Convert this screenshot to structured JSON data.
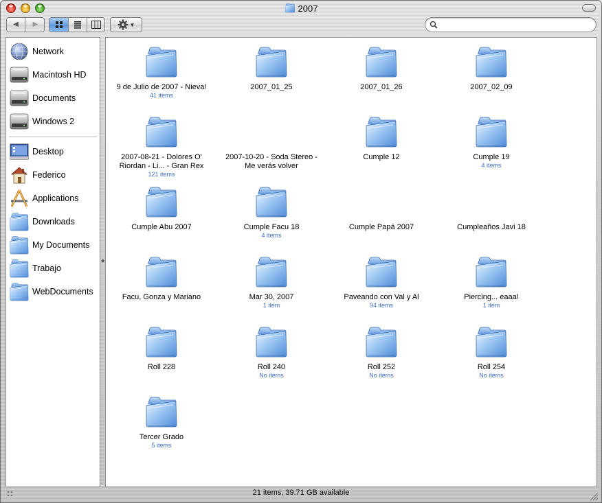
{
  "window": {
    "title": "2007"
  },
  "search": {
    "value": "",
    "placeholder": ""
  },
  "sidebar": {
    "devices": [
      {
        "label": "Network",
        "icon": "network-globe-icon"
      },
      {
        "label": "Macintosh HD",
        "icon": "hard-drive-icon"
      },
      {
        "label": "Documents",
        "icon": "hard-drive-icon"
      },
      {
        "label": "Windows 2",
        "icon": "hard-drive-icon"
      }
    ],
    "places": [
      {
        "label": "Desktop",
        "icon": "desktop-icon"
      },
      {
        "label": "Federico",
        "icon": "home-icon"
      },
      {
        "label": "Applications",
        "icon": "applications-icon"
      },
      {
        "label": "Downloads",
        "icon": "folder-icon"
      },
      {
        "label": "My Documents",
        "icon": "folder-icon"
      },
      {
        "label": "Trabajo",
        "icon": "folder-icon"
      },
      {
        "label": "WebDocuments",
        "icon": "folder-icon"
      }
    ]
  },
  "items": [
    {
      "name": "9 de Julio de 2007 - Nieva!",
      "count": "41 items"
    },
    {
      "name": "2007_01_25",
      "count": ""
    },
    {
      "name": "2007_01_26",
      "count": ""
    },
    {
      "name": "2007_02_09",
      "count": ""
    },
    {
      "name": "2007-08-21 - Dolores O' Riordan - Li... - Gran Rex",
      "count": "121 items"
    },
    {
      "name": "2007-10-20 - Soda Stereo - Me verás volver",
      "count": ""
    },
    {
      "name": "Cumple 12",
      "count": ""
    },
    {
      "name": "Cumple 19",
      "count": "4 items"
    },
    {
      "name": "Cumple Abu 2007",
      "count": ""
    },
    {
      "name": "Cumple Facu 18",
      "count": "4 items"
    },
    {
      "name": "Cumple Papá 2007",
      "count": ""
    },
    {
      "name": "Cumpleaños Javi 18",
      "count": ""
    },
    {
      "name": "Facu, Gonza y Mariano",
      "count": ""
    },
    {
      "name": "Mar 30, 2007",
      "count": "1 item"
    },
    {
      "name": "Paveando con Val y Al",
      "count": "94 items"
    },
    {
      "name": "Piercing... eaaa!",
      "count": "1 item"
    },
    {
      "name": "Roll 228",
      "count": ""
    },
    {
      "name": "Roll 240",
      "count": "No items"
    },
    {
      "name": "Roll 252",
      "count": "No items"
    },
    {
      "name": "Roll 254",
      "count": "No items"
    },
    {
      "name": "Tercer Grado",
      "count": "5 items"
    }
  ],
  "status": {
    "text": "21 items, 39.71 GB available"
  }
}
